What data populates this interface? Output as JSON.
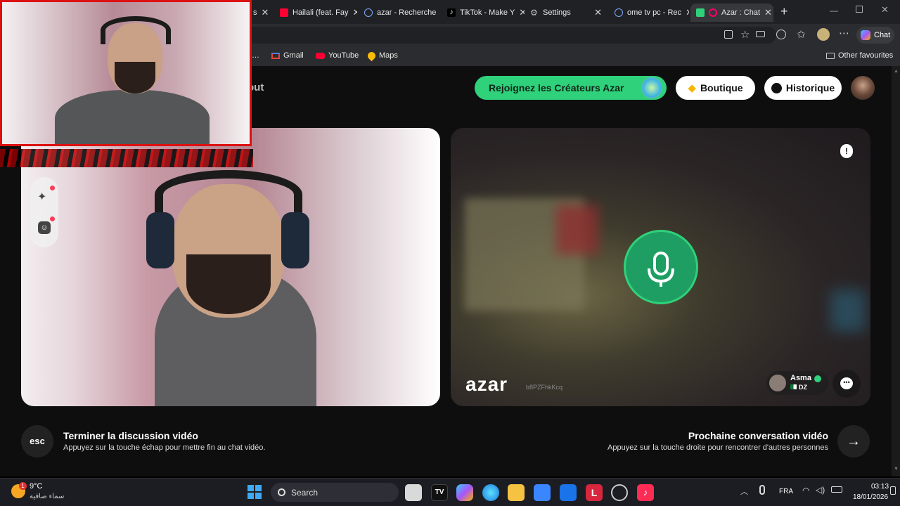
{
  "tabs": [
    {
      "label": "s",
      "icon": "youtube-icon"
    },
    {
      "label": "Hailali (feat. Fay",
      "icon": "youtube-icon"
    },
    {
      "label": "azar - Recherche",
      "icon": "search-icon"
    },
    {
      "label": "TikTok - Make Y",
      "icon": "tiktok-icon"
    },
    {
      "label": "Settings",
      "icon": "gear-icon"
    },
    {
      "label": "ome tv pc - Rec",
      "icon": "search-icon"
    },
    {
      "label": "Azar : Chat",
      "icon": "azar-icon"
    }
  ],
  "toolbar": {
    "chat_label": "Chat"
  },
  "bookmarks": [
    {
      "label": "Gmail",
      "icon": "gmail-icon"
    },
    {
      "label": "YouTube",
      "icon": "youtube-icon"
    },
    {
      "label": "Maps",
      "icon": "maps-icon"
    }
  ],
  "other_favourites": "Other favourites",
  "header": {
    "partial_text": "out",
    "creators_label": "Rejoignez les Créateurs Azar",
    "shop_label": "Boutique",
    "history_label": "Historique"
  },
  "remote": {
    "brand": "azar",
    "session_code": "b8PZFhkKcq",
    "peer_name": "Asma",
    "peer_country": "DZ"
  },
  "footer": {
    "esc_key": "esc",
    "end_title": "Terminer la discussion vidéo",
    "end_hint": "Appuyez sur la touche échap pour mettre fin au chat vidéo.",
    "next_title": "Prochaine conversation vidéo",
    "next_hint": "Appuyez sur la touche droite pour rencontrer d'autres personnes"
  },
  "taskbar": {
    "weather_temp": "9°C",
    "weather_desc": "سماء صافية",
    "weather_badge": "1",
    "search_placeholder": "Search",
    "language": "FRA",
    "time": "03:13",
    "date": "18/01/2026"
  },
  "colors": {
    "accent_green": "#2fd17a",
    "mic_green": "#1f9e63",
    "webcam_border": "#dd1111"
  }
}
